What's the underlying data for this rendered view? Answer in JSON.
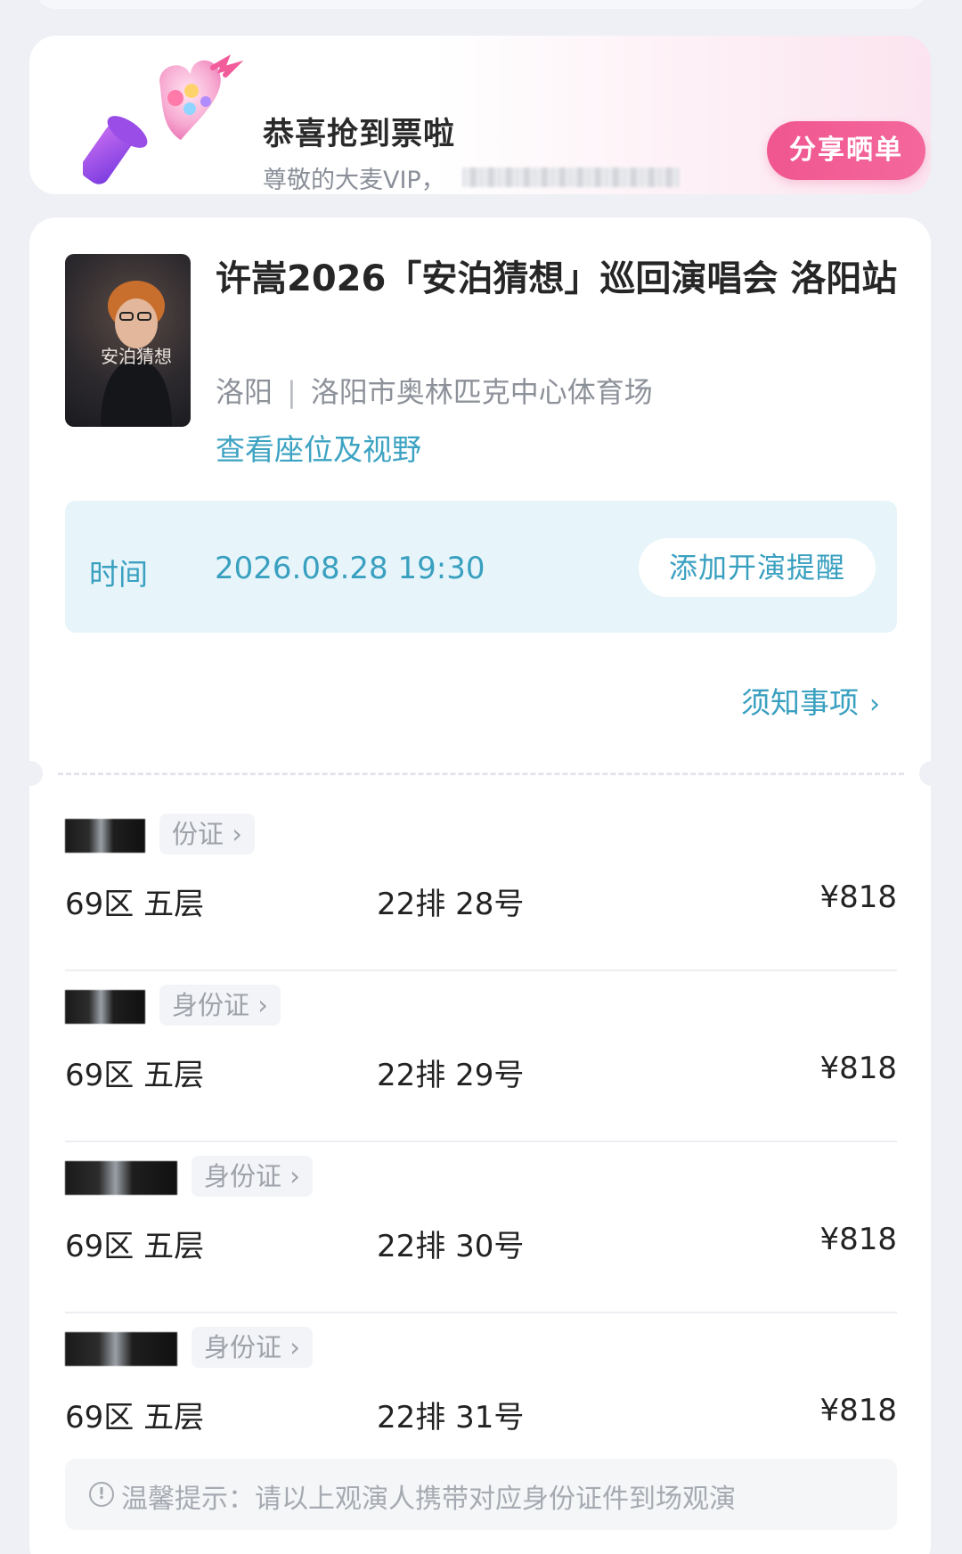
{
  "banner": {
    "title": "恭喜抢到票啦",
    "subtitle": "尊敬的大麦VIP，",
    "share_label": "分享晒单"
  },
  "event": {
    "title": "许嵩2026「安泊猜想」巡回演唱会 洛阳站",
    "city": "洛阳",
    "separator": "|",
    "venue": "洛阳市奥林匹克中心体育场",
    "seat_view_link": "查看座位及视野",
    "poster_text": "安泊猜想"
  },
  "time": {
    "label": "时间",
    "value": "2026.08.28 19:30",
    "remind_label": "添加开演提醒"
  },
  "notice": {
    "label": "须知事项",
    "chevron": "›"
  },
  "attendees": [
    {
      "id_label": "份证 ›",
      "zone": "69区 五层",
      "seat": "22排 28号",
      "price": "¥818"
    },
    {
      "id_label": "身份证 ›",
      "zone": "69区 五层",
      "seat": "22排 29号",
      "price": "¥818"
    },
    {
      "id_label": "身份证 ›",
      "zone": "69区 五层",
      "seat": "22排 30号",
      "price": "¥818"
    },
    {
      "id_label": "身份证 ›",
      "zone": "69区 五层",
      "seat": "22排 31号",
      "price": "¥818"
    }
  ],
  "tip": {
    "icon": "!",
    "text": "温馨提示：请以上观演人携带对应身份证件到场观演"
  },
  "colors": {
    "accent_blue": "#3aa0c0",
    "share_pink": "#f0568f",
    "time_box_bg": "#e7f5fb"
  },
  "icons": {
    "lightstick": "heart-lightstick-icon",
    "tip": "info-circle-icon",
    "notice_chevron": "chevron-right-icon"
  }
}
